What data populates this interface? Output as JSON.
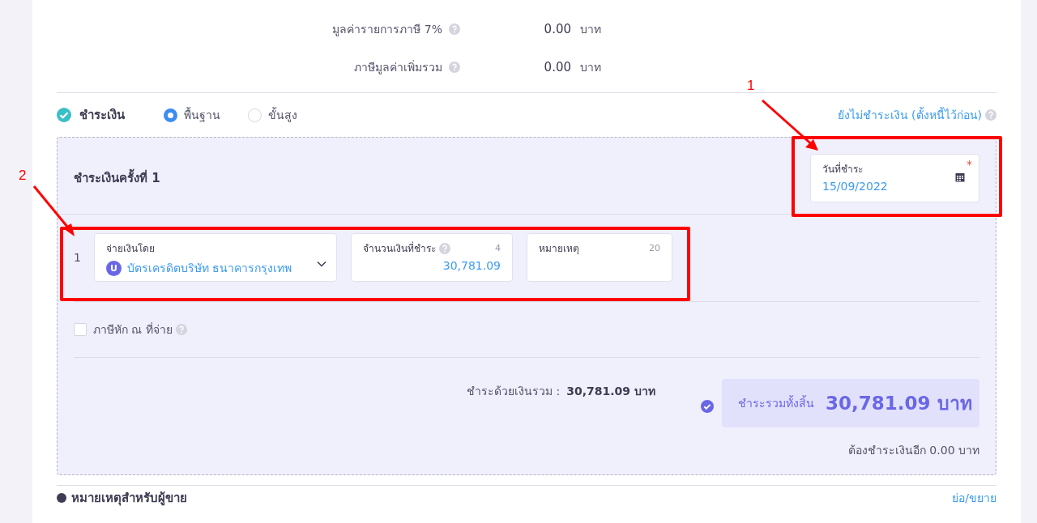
{
  "tax_rows": [
    {
      "label": "มูลค่ารายการภาษี 7%",
      "value": "0.00",
      "unit": "บาท"
    },
    {
      "label": "ภาษีมูลค่าเพิ่มรวม",
      "value": "0.00",
      "unit": "บาท"
    }
  ],
  "payment": {
    "title": "ชำระเงิน",
    "checked": true,
    "modes": [
      {
        "label": "พื้นฐาน",
        "selected": true
      },
      {
        "label": "ขั้นสูง",
        "selected": false
      }
    ],
    "defer_link": "ยังไม่ชำระเงิน (ตั้งหนี้ไว้ก่อน)",
    "installment": {
      "title": "ชำระเงินครั้งที่ 1",
      "date_field": {
        "label": "วันที่ชำระ",
        "required_mark": "*",
        "value": "15/09/2022"
      },
      "lines": [
        {
          "number": "1",
          "method": {
            "label": "จ่ายเงินโดย",
            "avatar": "U",
            "value": "บัตรเครดิตบริษัท ธนาคารกรุงเทพ"
          },
          "amount": {
            "label": "จำนวนเงินที่ชำระ",
            "counter": "4",
            "value": "30,781.09"
          },
          "note": {
            "label": "หมายเหตุ",
            "counter": "20"
          }
        }
      ],
      "withholding": {
        "label": "ภาษีหัก ณ ที่จ่าย",
        "checked": false
      },
      "paid_total_label": "ชำระด้วยเงินรวม :",
      "paid_total_value": "30,781.09 บาท",
      "grand_total": {
        "label": "ชำระรวมทั้งสิ้น",
        "value": "30,781.09 บาท",
        "complete": true
      },
      "remaining": "ต้องชำระเงินอีก 0.00 บาท"
    }
  },
  "seller_note": {
    "title": "หมายเหตุสำหรับผู้ขาย",
    "toggle": "ย่อ/ขยาย"
  },
  "annotations": [
    {
      "label": "1"
    },
    {
      "label": "2"
    }
  ]
}
